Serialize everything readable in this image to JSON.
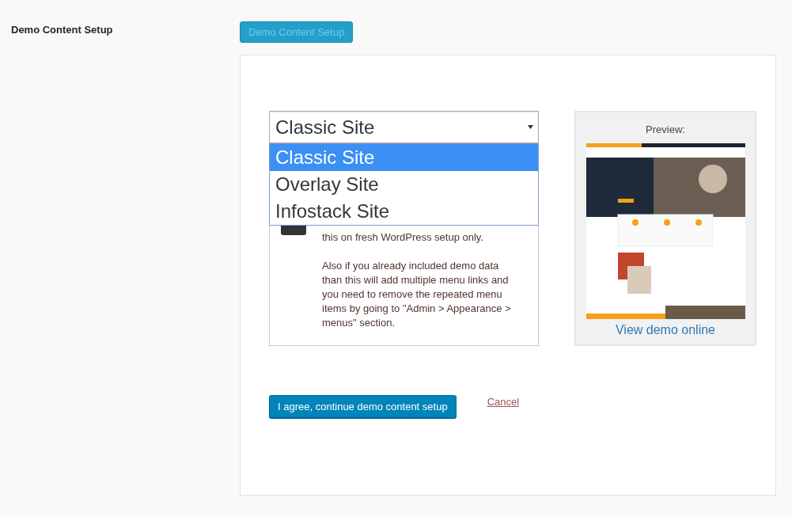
{
  "setting": {
    "label": "Demo Content Setup"
  },
  "setup_button": {
    "label": "Demo Content Setup",
    "disabled": true
  },
  "site_select": {
    "value": "Classic Site",
    "expanded": true,
    "options": [
      {
        "label": "Classic Site",
        "selected": true
      },
      {
        "label": "Overlay Site",
        "selected": false
      },
      {
        "label": "Infostack Site",
        "selected": false
      }
    ]
  },
  "warning": {
    "paragraphs": [
      "this on fresh WordPress setup only.",
      "Also if you already included demo data than this will add multiple menu links and you need to remove the repeated menu items by going to \"Admin > Appearance > menus\" section."
    ]
  },
  "preview": {
    "title": "Preview:",
    "link": "View demo online"
  },
  "agree_button": "I agree, continue demo content setup",
  "cancel_link": "Cancel"
}
